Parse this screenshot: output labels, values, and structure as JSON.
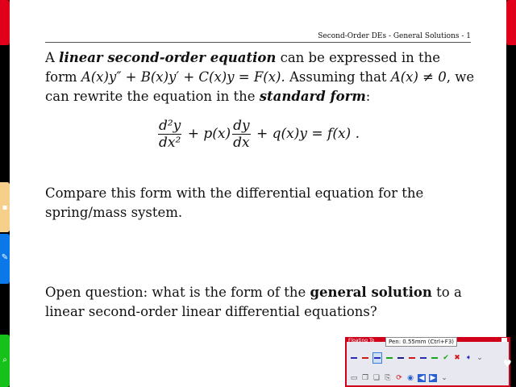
{
  "header": {
    "text": "Second-Order DEs - General Solutions - 1"
  },
  "para1": {
    "w1": "A ",
    "term": "linear second-order equation",
    "w2": " can be expressed in the form",
    "eq_inline": "A(x)y″ + B(x)y′ + C(x)y = F(x).",
    "w3": " Assuming that ",
    "cond": "A(x) ≠ 0",
    "w4": ", we can rewrite the equation in the ",
    "term2": "standard form",
    "w5": ":"
  },
  "equation": {
    "f1_num": "d²y",
    "f1_den": "dx²",
    "mid1": " + p(x)",
    "f2_num": "dy",
    "f2_den": "dx",
    "tail": " + q(x)y = f(x) ."
  },
  "para2": {
    "text": "Compare this form with the differential equation for the spring/mass system."
  },
  "para3": {
    "w1": "Open question: what is the form of the ",
    "term": "general solution",
    "w2": " to a linear second-order linear differential equations?"
  },
  "toolbar": {
    "title": "Floating To",
    "tooltip": "Pen: 0.55mm (Ctrl+F3)",
    "pen_colors": [
      "#2a2ab8",
      "#d01a1a",
      "#2a2ab8",
      "#18a818",
      "#1a1a8a",
      "#d01a1a",
      "#2a2ab8",
      "#18a818"
    ],
    "accent": "#d0001a"
  }
}
